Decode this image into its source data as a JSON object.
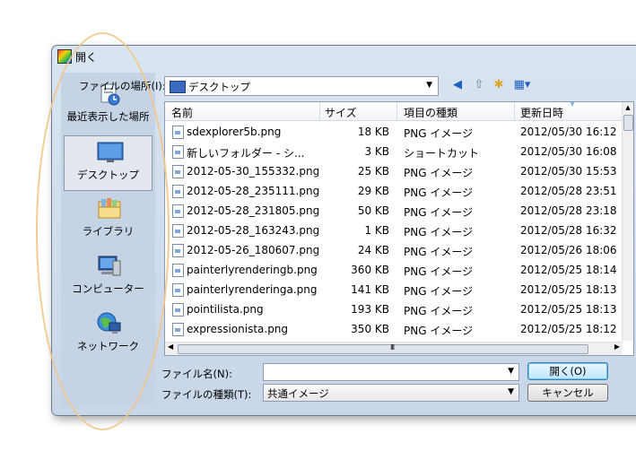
{
  "window": {
    "title": "開く"
  },
  "places": [
    {
      "label": "最近表示した場所",
      "icon": "recent-places-icon"
    },
    {
      "label": "デスクトップ",
      "icon": "desktop-icon"
    },
    {
      "label": "ライブラリ",
      "icon": "libraries-icon"
    },
    {
      "label": "コンピューター",
      "icon": "computer-icon"
    },
    {
      "label": "ネットワーク",
      "icon": "network-icon"
    }
  ],
  "lookin": {
    "label": "ファイルの場所(I):",
    "value": "デスクトップ"
  },
  "columns": {
    "name": "名前",
    "size": "サイズ",
    "type": "項目の種類",
    "date": "更新日時"
  },
  "files": [
    {
      "name": "sdexplorer5b.png",
      "size": "18 KB",
      "type": "PNG イメージ",
      "date": "2012/05/30 16:12"
    },
    {
      "name": "新しいフォルダー - シ...",
      "size": "3 KB",
      "type": "ショートカット",
      "date": "2012/05/30 16:08"
    },
    {
      "name": "2012-05-30_155332.png",
      "size": "25 KB",
      "type": "PNG イメージ",
      "date": "2012/05/30 15:53"
    },
    {
      "name": "2012-05-28_235111.png",
      "size": "29 KB",
      "type": "PNG イメージ",
      "date": "2012/05/28 23:51"
    },
    {
      "name": "2012-05-28_231805.png",
      "size": "50 KB",
      "type": "PNG イメージ",
      "date": "2012/05/28 23:18"
    },
    {
      "name": "2012-05-28_163243.png",
      "size": "1 KB",
      "type": "PNG イメージ",
      "date": "2012/05/28 16:32"
    },
    {
      "name": "2012-05-26_180607.png",
      "size": "24 KB",
      "type": "PNG イメージ",
      "date": "2012/05/26 18:06"
    },
    {
      "name": "painterlyrenderingb.png",
      "size": "360 KB",
      "type": "PNG イメージ",
      "date": "2012/05/25 18:14"
    },
    {
      "name": "painterlyrenderinga.png",
      "size": "141 KB",
      "type": "PNG イメージ",
      "date": "2012/05/25 18:13"
    },
    {
      "name": "pointilista.png",
      "size": "193 KB",
      "type": "PNG イメージ",
      "date": "2012/05/25 18:13"
    },
    {
      "name": "expressionista.png",
      "size": "350 KB",
      "type": "PNG イメージ",
      "date": "2012/05/25 18:12"
    }
  ],
  "filename": {
    "label": "ファイル名(N):",
    "value": ""
  },
  "filetype": {
    "label": "ファイルの種類(T):",
    "value": "共通イメージ"
  },
  "buttons": {
    "open": "開く(O)",
    "cancel": "キャンセル"
  }
}
